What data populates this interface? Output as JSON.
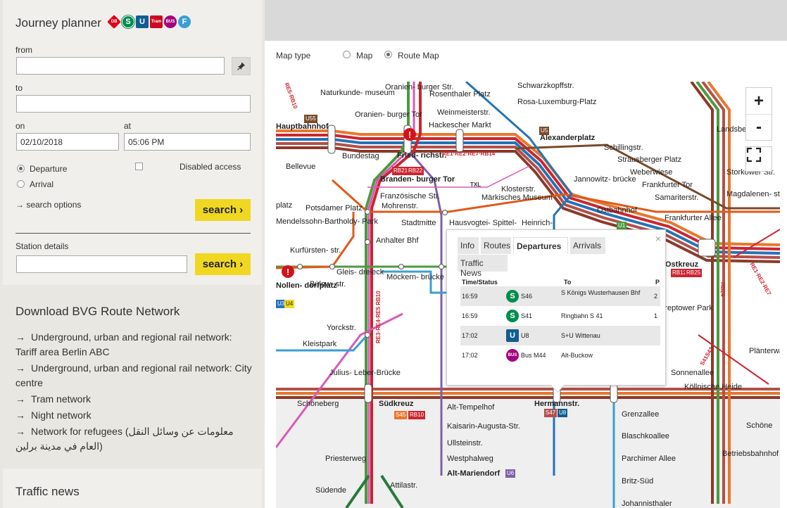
{
  "planner": {
    "title": "Journey planner",
    "mode_icons": [
      "db-icon",
      "s-bahn-icon",
      "u-bahn-icon",
      "tram-icon",
      "bus-icon",
      "ferry-icon"
    ],
    "mode_labels": {
      "db": "DB",
      "s": "S",
      "u": "U",
      "tram": "Tram",
      "bus": "BUS",
      "f": "F"
    },
    "from_label": "from",
    "from_value": "",
    "to_label": "to",
    "to_value": "",
    "on_label": "on",
    "date_value": "02/10/2018",
    "at_label": "at",
    "time_value": "05:06 PM",
    "departure_label": "Departure",
    "arrival_label": "Arrival",
    "selected_mode": "Departure",
    "disabled_access_label": "Disabled access",
    "search_options_label": "→ search options",
    "search_label": "search ›"
  },
  "station_details": {
    "label": "Station details",
    "value": "",
    "search_label": "search ›"
  },
  "download": {
    "title": "Download BVG Route Network",
    "items": [
      "Underground, urban and regional rail network: Tariff area Berlin ABC",
      "Underground, urban and regional rail network: City centre",
      "Tram network",
      "Night network",
      "Network for refugees (معلومات عن وسائل النقل العام في مدينة برلين)"
    ],
    "arrow": "→"
  },
  "traffic_news": {
    "title": "Traffic news"
  },
  "map": {
    "type_label": "Map type",
    "options": [
      "Map",
      "Route Map"
    ],
    "selected": "Route Map",
    "zoom_in": "+",
    "zoom_out": "-",
    "colors": {
      "s_ring": "#b2504a",
      "s_orange": "#e8782d",
      "u_blue": "#2573b7",
      "u_green": "#4b9a3f",
      "u_purple": "#7d60a8",
      "tram_pink": "#d95ab6",
      "regional": "#cc2530"
    },
    "stations": [
      "Oranien- burger Str.",
      "Rosenthaler Platz",
      "Weinmeisterstr.",
      "Hackescher Markt",
      "Alexanderplatz",
      "Schillingstr.",
      "Strausberger Platz",
      "Weberwiese",
      "Frankfurter Tor",
      "Samariterstr.",
      "Naturkunde- museum",
      "Oranien- burger Tor",
      "Hauptbahnhof",
      "Bundestag",
      "Fried- richstr.",
      "Bellevue",
      "Branden- burger Tor",
      "Französische Str.",
      "Mohrenstr.",
      "Klosterstr.",
      "Märkisches Museum",
      "Jannowitz- brücke",
      "Ostbahnhof",
      "Potsdamer Platz",
      "Stadtmitte",
      "Hausvogtei- Spittel-",
      "Heinrich-",
      "Mendelssohn-Bartholdy- Park",
      "Anhalter Bhf",
      "Kurfürsten- str.",
      "Gleis- dreieck",
      "Nollen- dorfplatz",
      "Bülow- str.",
      "Möckern- brücke",
      "Yorckstr.",
      "Kleistpark",
      "Julius- Leber-Brücke",
      "Schöneberg",
      "Südkreuz",
      "Alt-Tempelhof",
      "Kaisarin-Augusta-Str.",
      "Ullsteinstr.",
      "Westphalweg",
      "Alt-Mariendorf",
      "Priesterweg",
      "Attilastr.",
      "Südende",
      "Hermannstr.",
      "Grenzallee",
      "Blaschkoallee",
      "Parchimer Allee",
      "Britz-Süd",
      "Johannisthaler",
      "Ostkreuz",
      "Frankfurter Allee",
      "Storkower Str.",
      "Landsberger",
      "Magdalenen- str.",
      "Sonnenallee",
      "Köllnische Heide",
      "Treptower Park",
      "Plänterwald",
      "Schöne",
      "Betriebsbahnhof",
      "Rosa-Luxemburg-Platz",
      "Schwarzkopffstr.",
      "platz",
      "Kleistpark"
    ],
    "line_tags": [
      "RE1·RE2·RE7·RB14",
      "RE3·RE4·RE5 RB10",
      "RE5·RB10",
      "RE1·RE2·RE7",
      "RB24",
      "S41S42",
      "U5",
      "U55",
      "RB21",
      "RB22",
      "U1",
      "U3",
      "U4",
      "S45",
      "RB10",
      "S47",
      "U8",
      "U6",
      "RB12",
      "RB25",
      "TXL"
    ]
  },
  "popup": {
    "tabs": [
      "Info",
      "Routes",
      "Departures",
      "Arrivals",
      "Traffic News"
    ],
    "active_tab": "Departures",
    "close": "×",
    "headers": {
      "time": "Time/Status",
      "to": "To",
      "platform": "P"
    },
    "rows": [
      {
        "time": "16:59",
        "badge": "S",
        "badge_color": "#008d4f",
        "line": "S46",
        "to": "S Königs Wusterhausen Bhf",
        "platform": "2"
      },
      {
        "time": "16:59",
        "badge": "S",
        "badge_color": "#008d4f",
        "line": "S41",
        "to": "Ringbahn S 41",
        "platform": "1"
      },
      {
        "time": "17:02",
        "badge": "U",
        "badge_color": "#115d91",
        "line": "U8",
        "to": "S+U Wittenau",
        "platform": ""
      },
      {
        "time": "17:02",
        "badge": "BUS",
        "badge_color": "#a5027d",
        "line": "Bus M44",
        "to": "Alt-Buckow",
        "platform": ""
      }
    ]
  }
}
